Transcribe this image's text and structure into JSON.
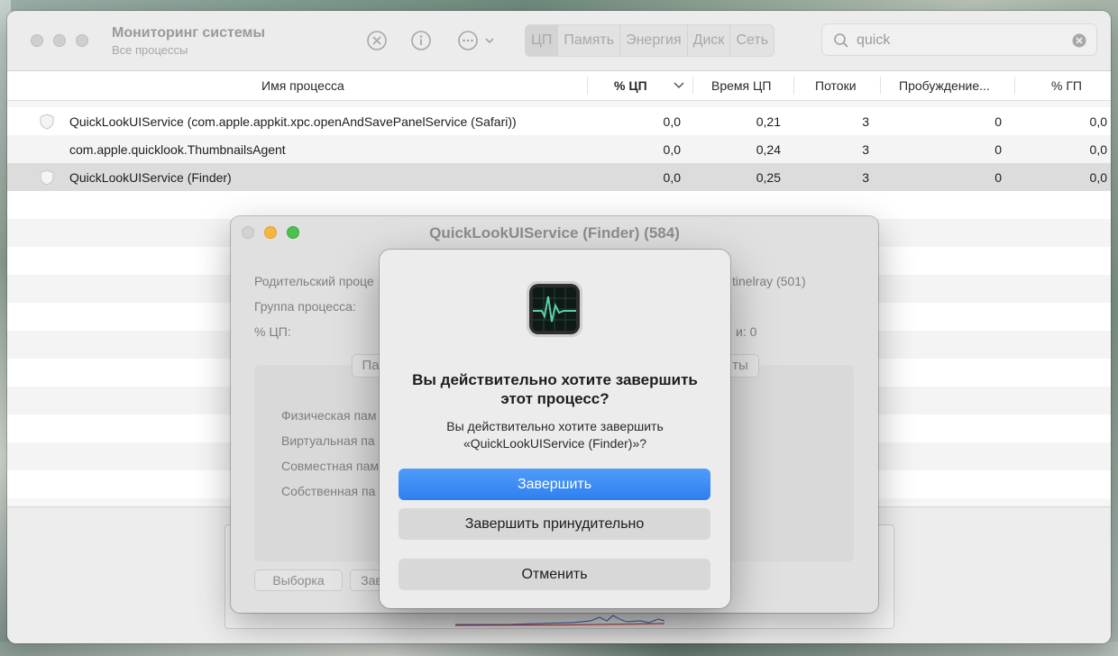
{
  "window": {
    "title": "Мониторинг системы",
    "subtitle": "Все процессы",
    "tabs": [
      {
        "label": "ЦП",
        "active": true
      },
      {
        "label": "Память"
      },
      {
        "label": "Энергия"
      },
      {
        "label": "Диск"
      },
      {
        "label": "Сеть"
      }
    ],
    "search": {
      "value": "quick",
      "placeholder": ""
    }
  },
  "table": {
    "columns": [
      "Имя процесса",
      "% ЦП",
      "Время ЦП",
      "Потоки",
      "Пробуждение...",
      "% ГП"
    ],
    "rows": [
      {
        "name": "QuickLookUIService (com.apple.appkit.xpc.openAndSavePanelService (Safari))",
        "cpu": "0,0",
        "time": "0,21",
        "threads": "3",
        "wakeups": "0",
        "gpu": "0,0",
        "icon": "shield-icon"
      },
      {
        "name": "com.apple.quicklook.ThumbnailsAgent",
        "cpu": "0,0",
        "time": "0,24",
        "threads": "3",
        "wakeups": "0",
        "gpu": "0,0"
      },
      {
        "name": "QuickLookUIService (Finder)",
        "cpu": "0,0",
        "time": "0,25",
        "threads": "3",
        "wakeups": "0",
        "gpu": "0,0",
        "icon": "shield-icon",
        "selected": true
      }
    ]
  },
  "info_window": {
    "title": "QuickLookUIService (Finder) (584)",
    "labels": [
      "Родительский проце",
      "Группа процесса:",
      "% ЦП:",
      "tinelray (501)",
      "и:  0"
    ],
    "tabs_partial": [
      "Па",
      "ты"
    ],
    "memory_labels": [
      "Физическая пам",
      "Виртуальная па",
      "Совместная пам",
      "Собственная па"
    ],
    "buttons": [
      "Выборка",
      "Зав"
    ]
  },
  "dialog": {
    "title": "Вы действительно хотите завершить этот процесс?",
    "message": "Вы действительно хотите завершить «QuickLookUIService (Finder)»?",
    "quit": "Завершить",
    "force_quit": "Завершить принудительно",
    "cancel": "Отменить"
  },
  "colors": {
    "accent": "#3a87f5",
    "selected_row": "#dcdcdc"
  }
}
